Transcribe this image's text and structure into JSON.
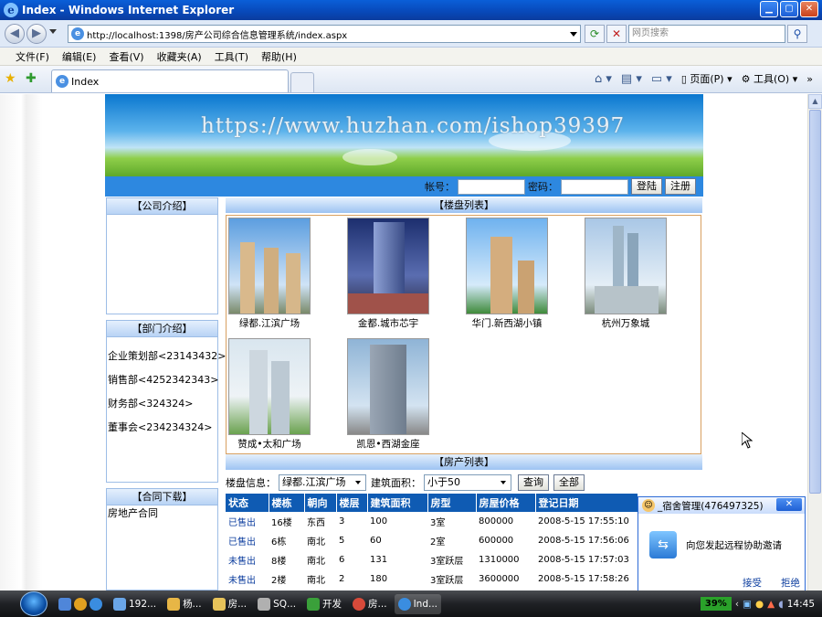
{
  "window": {
    "title": "Index - Windows Internet Explorer"
  },
  "address": {
    "url": "http://localhost:1398/房产公司综合信息管理系统/index.aspx",
    "search_placeholder": "网页搜索"
  },
  "menu": [
    "文件(F)",
    "编辑(E)",
    "查看(V)",
    "收藏夹(A)",
    "工具(T)",
    "帮助(H)"
  ],
  "tab": {
    "label": "Index"
  },
  "commands": {
    "page": "页面(P)",
    "tools": "工具(O)"
  },
  "banner": {
    "watermark": "https://www.huzhan.com/ishop39397"
  },
  "login": {
    "account_label": "帐号：",
    "password_label": "密码：",
    "login_button": "登陆",
    "register_button": "注册"
  },
  "side": {
    "company_title": "【公司介绍】",
    "dept_title": "【部门介绍】",
    "departments": [
      "企业策划部<23143432>",
      "销售部<4252342343>",
      "财务部<324324>",
      "董事会<234234324>"
    ],
    "contract_title": "【合同下载】",
    "contract_item": "房地产合同"
  },
  "buildings": {
    "title": "【楼盘列表】",
    "items": [
      "绿都.江滨广场",
      "金都.城市芯宇",
      "华门.新西湖小镇",
      "杭州万象城",
      "赞成•太和广场",
      "凯恩•西湖金座"
    ]
  },
  "houses": {
    "title": "【房产列表】",
    "filter_building_label": "楼盘信息：",
    "filter_building_value": "绿都.江滨广场",
    "filter_area_label": "建筑面积：",
    "filter_area_value": "小于50",
    "query_button": "查询",
    "all_button": "全部",
    "columns": [
      "状态",
      "楼栋",
      "朝向",
      "楼层",
      "建筑面积",
      "房型",
      "房屋价格",
      "登记日期"
    ],
    "rows": [
      [
        "已售出",
        "16楼",
        "东西",
        "3",
        "100",
        "3室",
        "800000",
        "2008-5-15 17:55:10"
      ],
      [
        "已售出",
        "6栋",
        "南北",
        "5",
        "60",
        "2室",
        "600000",
        "2008-5-15 17:56:06"
      ],
      [
        "未售出",
        "8楼",
        "南北",
        "6",
        "131",
        "3室跃层",
        "1310000",
        "2008-5-15 17:57:03"
      ],
      [
        "未售出",
        "2楼",
        "南北",
        "2",
        "180",
        "3室跃层",
        "3600000",
        "2008-5-15 17:58:26"
      ]
    ]
  },
  "popup": {
    "title": "_宿舍管理(476497325)",
    "message": "向您发起远程协助邀请",
    "accept": "接受",
    "reject": "拒绝"
  },
  "taskbar": {
    "tasks": [
      "192...",
      "杨...",
      "房...",
      "SQ...",
      "开发",
      "房...",
      "Ind..."
    ],
    "cpu": "39%",
    "clock": "14:45"
  }
}
